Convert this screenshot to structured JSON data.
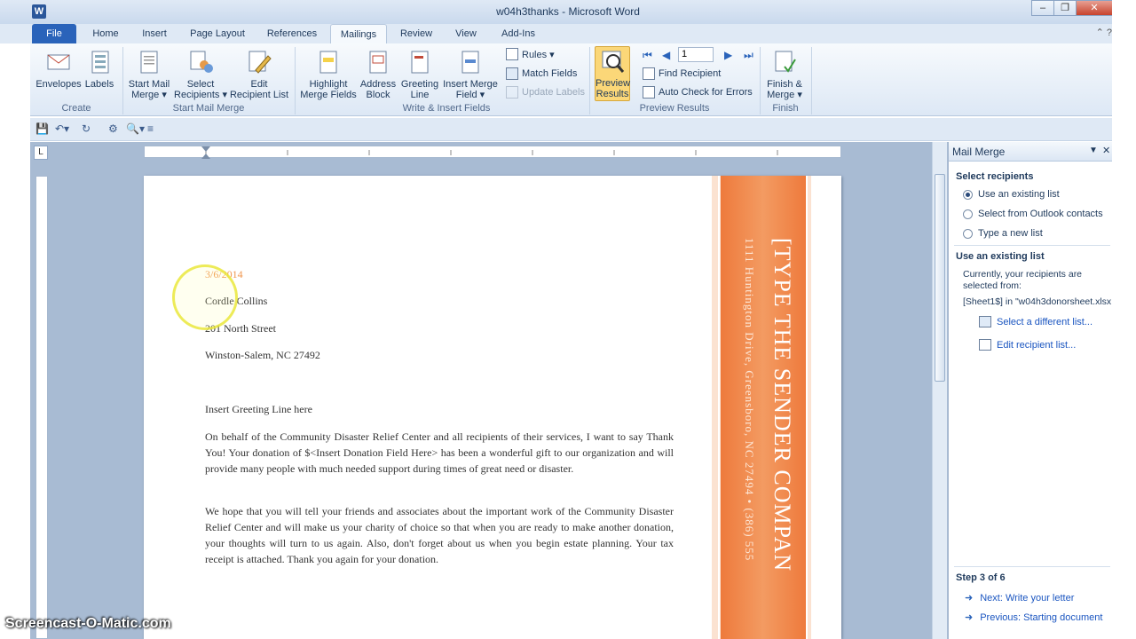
{
  "window": {
    "title": "w04h3thanks - Microsoft Word",
    "app_icon": "W",
    "min": "–",
    "restore": "❐",
    "close": "✕"
  },
  "tabs": [
    "File",
    "Home",
    "Insert",
    "Page Layout",
    "References",
    "Mailings",
    "Review",
    "View",
    "Add-Ins"
  ],
  "ribbon": {
    "create": {
      "envelopes": "Envelopes",
      "labels": "Labels",
      "group": "Create"
    },
    "start": {
      "start_mail_merge_1": "Start Mail",
      "start_mail_merge_2": "Merge ▾",
      "select_recipients_1": "Select",
      "select_recipients_2": "Recipients ▾",
      "edit_list_1": "Edit",
      "edit_list_2": "Recipient List",
      "group": "Start Mail Merge"
    },
    "write": {
      "highlight_1": "Highlight",
      "highlight_2": "Merge Fields",
      "address_1": "Address",
      "address_2": "Block",
      "greeting_1": "Greeting",
      "greeting_2": "Line",
      "insert_field_1": "Insert Merge",
      "insert_field_2": "Field ▾",
      "rules": "Rules ▾",
      "match_fields": "Match Fields",
      "update_labels": "Update Labels",
      "group": "Write & Insert Fields"
    },
    "preview": {
      "preview_1": "Preview",
      "preview_2": "Results",
      "record": "1",
      "find_recipient": "Find Recipient",
      "auto_check": "Auto Check for Errors",
      "group": "Preview Results"
    },
    "finish": {
      "finish_1": "Finish &",
      "finish_2": "Merge ▾",
      "group": "Finish"
    }
  },
  "ruler_corner": "L",
  "document": {
    "date": "3/6/2014",
    "name": "Cordle Collins",
    "street": "201 North Street",
    "city": "Winston-Salem,  NC 27492",
    "greeting": "Insert Greeting Line here",
    "para1": "On behalf of the Community Disaster Relief Center and all recipients of their services, I want to say Thank You! Your donation of $<Insert Donation Field Here> has been a wonderful gift to our organization and will provide many people with much needed support during times of great need or disaster.",
    "para2": "We hope that you will tell your friends and associates about the important work of the Community Disaster Relief Center and will make us your charity of choice so that when you are ready to make another donation, your thoughts will turn to us again. Also, don't forget about us when you begin estate planning. Your tax receipt is attached. Thank you again for your donation.",
    "sender": "[TYPE THE SENDER COMPAN",
    "address": "1111 Huntington Drive, Greensboro, NC 27494 • (386) 555"
  },
  "pane": {
    "title": "Mail Merge",
    "select_recipients": "Select recipients",
    "opt_existing": "Use an existing list",
    "opt_outlook": "Select from Outlook contacts",
    "opt_new": "Type a new list",
    "use_existing": "Use an existing list",
    "currently_1": "Currently, your recipients are",
    "currently_2": "selected from:",
    "source": "[Sheet1$] in \"w04h3donorsheet.xlsx",
    "select_different": "Select a different list...",
    "edit_list": "Edit recipient list...",
    "step": "Step 3 of 6",
    "next": "Next: Write your letter",
    "previous": "Previous: Starting document"
  },
  "watermark": "Screencast-O-Matic.com",
  "colors": {
    "accent_orange": "#ee7a3c",
    "file_tab": "#2a63ba",
    "date_orange": "#f0964e"
  }
}
